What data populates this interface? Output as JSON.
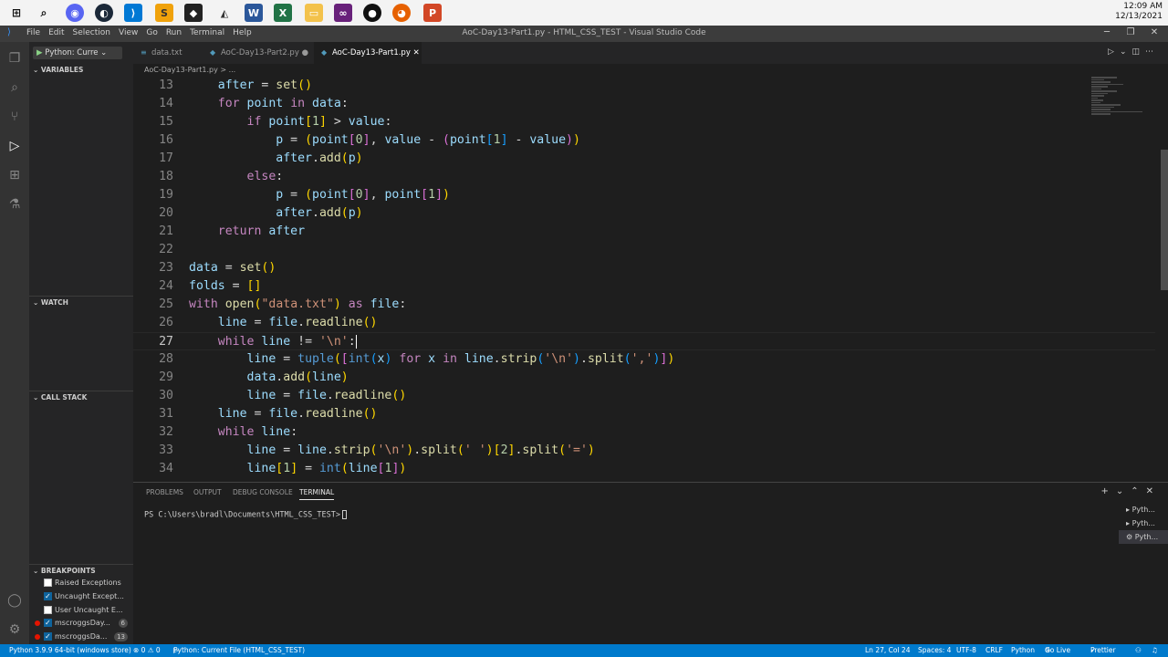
{
  "taskbar": {
    "time": "12:09 AM",
    "date": "12/13/2021"
  },
  "titlebar": {
    "menu": [
      "File",
      "Edit",
      "Selection",
      "View",
      "Go",
      "Run",
      "Terminal",
      "Help"
    ],
    "title": "AoC-Day13-Part1.py - HTML_CSS_TEST - Visual Studio Code"
  },
  "sidebar": {
    "run_config": "Python: Curre",
    "variables": "VARIABLES",
    "watch": "WATCH",
    "call_stack": "CALL STACK",
    "breakpoints": "BREAKPOINTS",
    "bp_items": [
      {
        "label": "Raised Exceptions",
        "checked": false
      },
      {
        "label": "Uncaught Except...",
        "checked": true
      },
      {
        "label": "User Uncaught E...",
        "checked": false
      },
      {
        "label": "mscroggsDay...",
        "checked": true,
        "count": "6"
      },
      {
        "label": "mscroggsDa...",
        "checked": true,
        "count": "13"
      }
    ]
  },
  "tabs": [
    {
      "label": "data.txt"
    },
    {
      "label": "AoC-Day13-Part2.py"
    },
    {
      "label": "AoC-Day13-Part1.py"
    }
  ],
  "breadcrumb": "AoC-Day13-Part1.py > ...",
  "code": {
    "line_numbers": [
      "13",
      "14",
      "15",
      "16",
      "17",
      "18",
      "19",
      "20",
      "21",
      "22",
      "23",
      "24",
      "25",
      "26",
      "27",
      "28",
      "29",
      "30",
      "31",
      "32",
      "33",
      "34"
    ],
    "current_line": "27"
  },
  "panel": {
    "tabs": [
      "PROBLEMS",
      "OUTPUT",
      "DEBUG CONSOLE",
      "TERMINAL"
    ],
    "prompt": "PS C:\\Users\\bradl\\Documents\\HTML_CSS_TEST>",
    "terminals": [
      "Pyth...",
      "Pyth...",
      "Pyth..."
    ]
  },
  "status": {
    "interpreter": "Python 3.9.9 64-bit (windows store)",
    "problems": "⊗ 0 ⚠ 0",
    "debug": "Python: Current File (HTML_CSS_TEST)",
    "position": "Ln 27, Col 24",
    "spaces": "Spaces: 4",
    "encoding": "UTF-8",
    "eol": "CRLF",
    "language": "Python",
    "golive": "Go Live",
    "prettier": "Prettier"
  }
}
